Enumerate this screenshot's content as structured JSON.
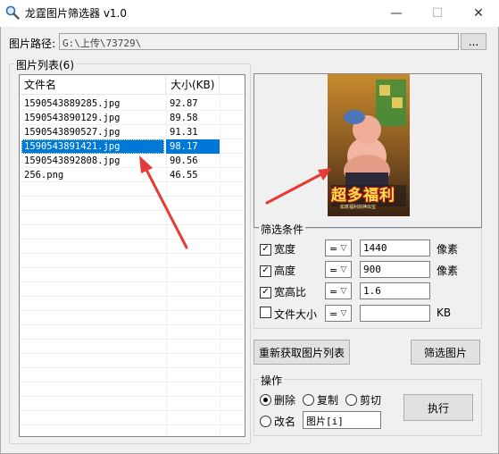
{
  "window": {
    "title": "龙霆图片筛选器 v1.0",
    "app_icon": "magnifier-icon",
    "minimize_glyph": "—",
    "maximize_glyph": "☐",
    "close_glyph": "✕"
  },
  "path": {
    "label": "图片路径:",
    "value": "G:\\上传\\73729\\",
    "browse_label": "..."
  },
  "image_list": {
    "group_label": "图片列表(6)",
    "columns": [
      "文件名",
      "大小(KB)"
    ],
    "rows": [
      {
        "name": "1590543889285.jpg",
        "size": "92.87"
      },
      {
        "name": "1590543890129.jpg",
        "size": "89.58"
      },
      {
        "name": "1590543890527.jpg",
        "size": "91.31"
      },
      {
        "name": "1590543891421.jpg",
        "size": "98.17"
      },
      {
        "name": "1590543892808.jpg",
        "size": "90.56"
      },
      {
        "name": "256.png",
        "size": "46.55"
      }
    ],
    "selected_index": 3
  },
  "preview": {
    "banner_text": "超多福利",
    "banner_subtext": "如意福利剑神出宝"
  },
  "filter": {
    "group_label": "筛选条件",
    "conditions": [
      {
        "label": "宽度",
        "checked": true,
        "operator": "=",
        "value": "1440",
        "unit": "像素"
      },
      {
        "label": "高度",
        "checked": true,
        "operator": "=",
        "value": "900",
        "unit": "像素"
      },
      {
        "label": "宽高比",
        "checked": true,
        "operator": "=",
        "value": "1.6",
        "unit": ""
      },
      {
        "label": "文件大小",
        "checked": false,
        "operator": "=",
        "value": "",
        "unit": "KB"
      }
    ]
  },
  "actions": {
    "refresh_label": "重新获取图片列表",
    "filter_label": "筛选图片"
  },
  "operation": {
    "group_label": "操作",
    "options": [
      {
        "label": "删除",
        "selected": true
      },
      {
        "label": "复制",
        "selected": false
      },
      {
        "label": "剪切",
        "selected": false
      },
      {
        "label": "改名",
        "selected": false
      }
    ],
    "rename_value": "图片[i]",
    "execute_label": "执行"
  },
  "colors": {
    "selection": "#0078d7",
    "arrow": "#e53a35",
    "window_bg": "#f0f0f0"
  }
}
